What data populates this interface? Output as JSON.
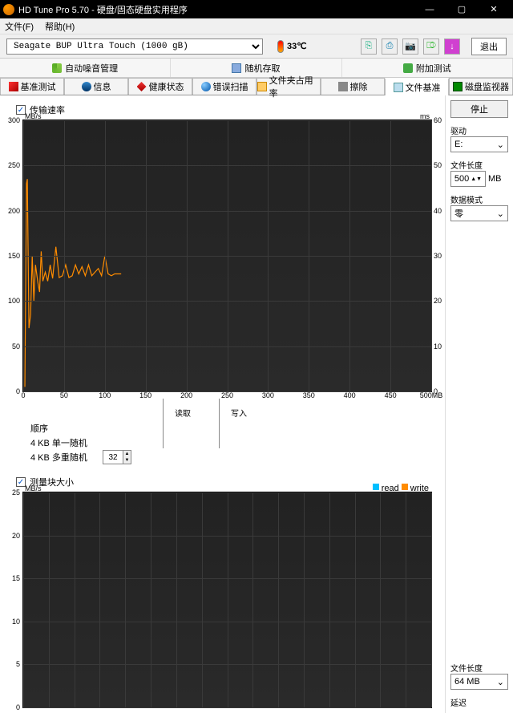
{
  "window": {
    "title": "HD Tune Pro 5.70 - 硬盘/固态硬盘实用程序"
  },
  "menu": {
    "file": "文件(F)",
    "help": "帮助(H)"
  },
  "toolbar": {
    "drive": "Seagate BUP Ultra Touch (1000 gB)",
    "temp": "33℃",
    "exit": "退出"
  },
  "func_tabs": {
    "aam": "自动噪音管理",
    "random": "随机存取",
    "extra": "附加测试"
  },
  "tabs": {
    "benchmark": "基准测试",
    "info": "信息",
    "health": "健康状态",
    "scan": "错误扫描",
    "folder": "文件夹占用率",
    "erase": "擦除",
    "filebench": "文件基准",
    "monitor": "磁盘监视器"
  },
  "sections": {
    "transfer": "传输速率",
    "blocksize": "测量块大小",
    "read_hdr": "读取",
    "write_hdr": "写入",
    "seq": "顺序",
    "rand_single": "4 KB 单一随机",
    "rand_multi": "4 KB 多重随机",
    "queue_depth": "32"
  },
  "side": {
    "stop": "停止",
    "drive_label": "驱动",
    "drive_letter": "E:",
    "filelen_label": "文件长度",
    "filelen_value": "500",
    "filelen_unit": "MB",
    "pattern_label": "数据模式",
    "pattern_value": "零",
    "filelen2_label": "文件长度",
    "filelen2_value": "64 MB",
    "latency_label": "延迟"
  },
  "chart_data": [
    {
      "type": "line",
      "title": "传输速率",
      "y_unit_left": "MB/s",
      "y_unit_right": "ms",
      "x_unit": "MB",
      "ylim_left": [
        0,
        300
      ],
      "ylim_right": [
        0,
        60
      ],
      "xlim": [
        0,
        500
      ],
      "y_ticks_left": [
        300,
        250,
        200,
        150,
        100,
        50,
        0
      ],
      "y_ticks_right": [
        60,
        50,
        40,
        30,
        20,
        10,
        0
      ],
      "x_ticks": [
        0,
        50,
        100,
        150,
        200,
        250,
        300,
        350,
        400,
        450,
        500
      ],
      "series": [
        {
          "name": "read",
          "color": "#ff8c00",
          "values": [
            [
              2,
              5
            ],
            [
              4,
              230
            ],
            [
              5,
              235
            ],
            [
              7,
              70
            ],
            [
              9,
              85
            ],
            [
              11,
              150
            ],
            [
              13,
              100
            ],
            [
              15,
              140
            ],
            [
              18,
              120
            ],
            [
              20,
              110
            ],
            [
              22,
              155
            ],
            [
              24,
              122
            ],
            [
              27,
              132
            ],
            [
              30,
              122
            ],
            [
              33,
              140
            ],
            [
              36,
              125
            ],
            [
              40,
              160
            ],
            [
              44,
              126
            ],
            [
              48,
              128
            ],
            [
              52,
              140
            ],
            [
              56,
              126
            ],
            [
              60,
              128
            ],
            [
              64,
              140
            ],
            [
              68,
              130
            ],
            [
              72,
              138
            ],
            [
              76,
              128
            ],
            [
              80,
              140
            ],
            [
              84,
              128
            ],
            [
              88,
              132
            ],
            [
              92,
              136
            ],
            [
              96,
              128
            ],
            [
              100,
              150
            ],
            [
              104,
              130
            ],
            [
              108,
              128
            ],
            [
              112,
              130
            ],
            [
              116,
              130
            ],
            [
              120,
              130
            ]
          ]
        }
      ]
    },
    {
      "type": "line",
      "title": "测量块大小",
      "y_unit_left": "MB/s",
      "ylim_left": [
        0,
        25
      ],
      "y_ticks_left": [
        25,
        20,
        15,
        10,
        5,
        0
      ],
      "legend": [
        {
          "name": "read",
          "color": "#00bfff"
        },
        {
          "name": "write",
          "color": "#ff8c00"
        }
      ],
      "series": []
    }
  ]
}
